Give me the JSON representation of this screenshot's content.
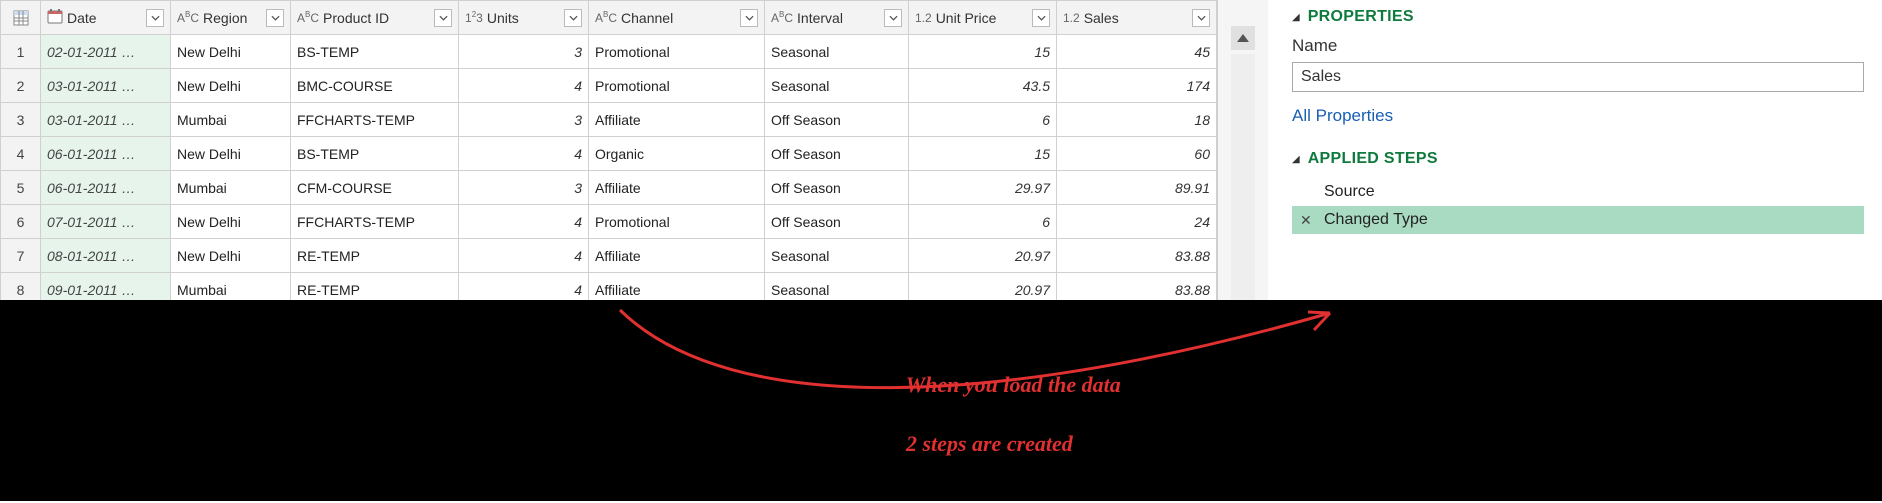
{
  "columns": [
    {
      "key": "date",
      "label": "Date",
      "type": "date"
    },
    {
      "key": "region",
      "label": "Region",
      "type": "text"
    },
    {
      "key": "product",
      "label": "Product ID",
      "type": "text"
    },
    {
      "key": "units",
      "label": "Units",
      "type": "int"
    },
    {
      "key": "channel",
      "label": "Channel",
      "type": "text"
    },
    {
      "key": "interval",
      "label": "Interval",
      "type": "text"
    },
    {
      "key": "price",
      "label": "Unit Price",
      "type": "dec"
    },
    {
      "key": "sales",
      "label": "Sales",
      "type": "dec"
    }
  ],
  "type_icons": {
    "date": "📆",
    "text": "AᴮC",
    "int": "1²3",
    "dec": "1.2"
  },
  "rows": [
    {
      "n": "1",
      "date": "02-01-2011 …",
      "region": "New Delhi",
      "product": "BS-TEMP",
      "units": "3",
      "channel": "Promotional",
      "interval": "Seasonal",
      "price": "15",
      "sales": "45"
    },
    {
      "n": "2",
      "date": "03-01-2011 …",
      "region": "New Delhi",
      "product": "BMC-COURSE",
      "units": "4",
      "channel": "Promotional",
      "interval": "Seasonal",
      "price": "43.5",
      "sales": "174"
    },
    {
      "n": "3",
      "date": "03-01-2011 …",
      "region": "Mumbai",
      "product": "FFCHARTS-TEMP",
      "units": "3",
      "channel": "Affiliate",
      "interval": "Off Season",
      "price": "6",
      "sales": "18"
    },
    {
      "n": "4",
      "date": "06-01-2011 …",
      "region": "New Delhi",
      "product": "BS-TEMP",
      "units": "4",
      "channel": "Organic",
      "interval": "Off Season",
      "price": "15",
      "sales": "60"
    },
    {
      "n": "5",
      "date": "06-01-2011 …",
      "region": "Mumbai",
      "product": "CFM-COURSE",
      "units": "3",
      "channel": "Affiliate",
      "interval": "Off Season",
      "price": "29.97",
      "sales": "89.91"
    },
    {
      "n": "6",
      "date": "07-01-2011 …",
      "region": "New Delhi",
      "product": "FFCHARTS-TEMP",
      "units": "4",
      "channel": "Promotional",
      "interval": "Off Season",
      "price": "6",
      "sales": "24"
    },
    {
      "n": "7",
      "date": "08-01-2011 …",
      "region": "New Delhi",
      "product": "RE-TEMP",
      "units": "4",
      "channel": "Affiliate",
      "interval": "Seasonal",
      "price": "20.97",
      "sales": "83.88"
    },
    {
      "n": "8",
      "date": "09-01-2011 …",
      "region": "Mumbai",
      "product": "RE-TEMP",
      "units": "4",
      "channel": "Affiliate",
      "interval": "Seasonal",
      "price": "20.97",
      "sales": "83.88"
    }
  ],
  "panel": {
    "properties_title": "PROPERTIES",
    "name_label": "Name",
    "name_value": "Sales",
    "all_properties": "All Properties",
    "applied_steps_title": "APPLIED STEPS",
    "steps": [
      {
        "label": "Source",
        "active": false,
        "deletable": false
      },
      {
        "label": "Changed Type",
        "active": true,
        "deletable": true
      }
    ]
  },
  "annotation": {
    "line1": "When you load the data",
    "line2": "2 steps are created"
  }
}
